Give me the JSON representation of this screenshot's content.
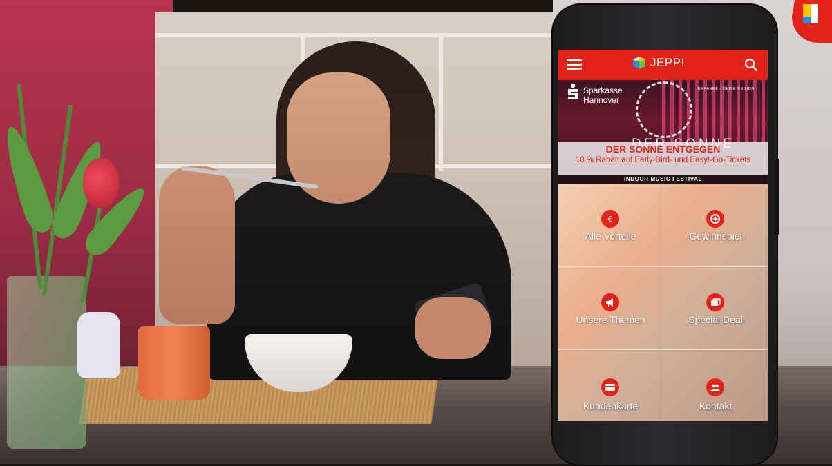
{
  "app": {
    "title": "JEPP!",
    "accent_color": "#e2231a",
    "menu_icon": "hamburger-menu-icon",
    "search_icon": "search-icon",
    "brand_icon": "gift-box-icon"
  },
  "banner": {
    "sponsor_line1": "Sparkasse",
    "sponsor_line2": "Hannover",
    "tagline": "ERFAHRE - DEINE REGION!",
    "ghost_text": "DER SONNE",
    "headline": "DER SONNE ENTGEGEN",
    "subline": "10 % Rabatt auf Early-Bird- und Easy!-Go-Tickets",
    "footer": "INDOOR MUSIC FESTIVAL"
  },
  "tiles": [
    {
      "label": "Alle Vorteile",
      "icon": "euro-coin-icon"
    },
    {
      "label": "Gewinnspiel",
      "icon": "prize-wheel-icon"
    },
    {
      "label": "Unsere Themen",
      "icon": "megaphone-icon"
    },
    {
      "label": "Special Deal",
      "icon": "cards-icon"
    },
    {
      "label": "Kundenkarte",
      "icon": "customer-card-icon"
    },
    {
      "label": "Kontakt",
      "icon": "contacts-icon"
    }
  ]
}
